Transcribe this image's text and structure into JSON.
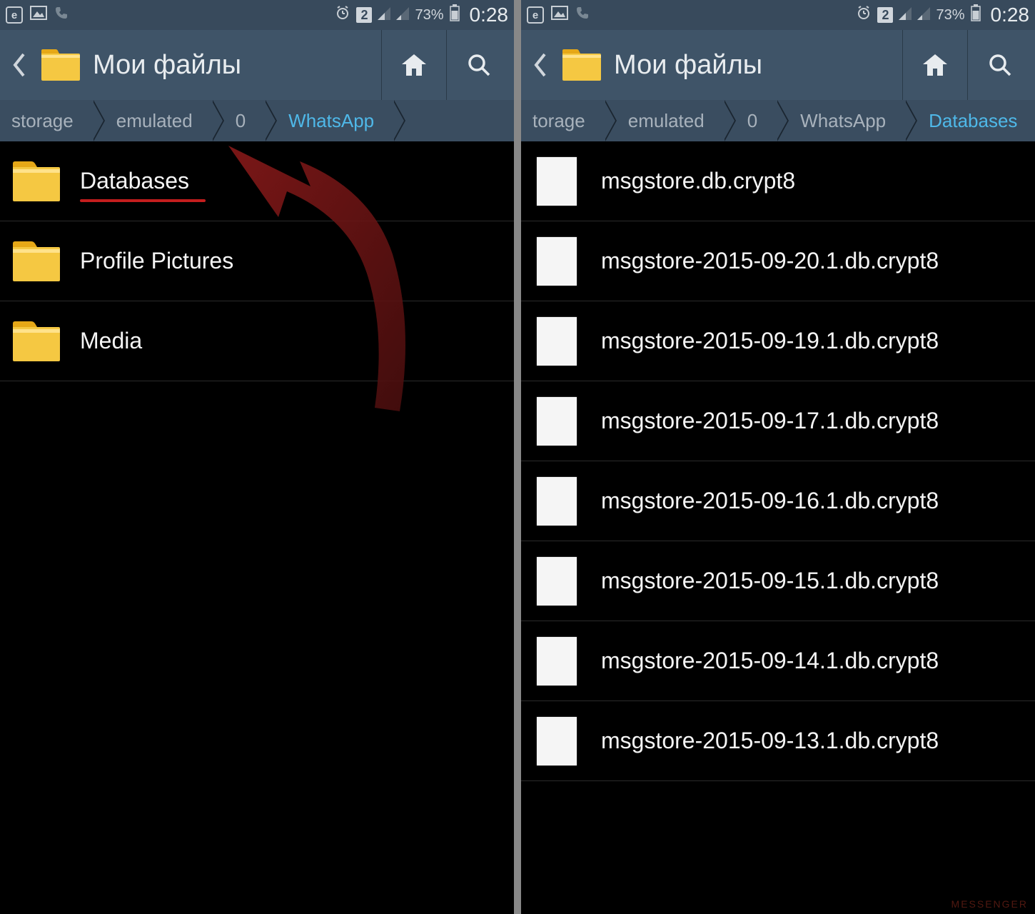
{
  "status": {
    "battery": "73%",
    "time": "0:28",
    "sim": "2"
  },
  "header": {
    "title": "Мои файлы"
  },
  "left": {
    "breadcrumb": [
      {
        "label": "storage",
        "active": false
      },
      {
        "label": "emulated",
        "active": false
      },
      {
        "label": "0",
        "active": false
      },
      {
        "label": "WhatsApp",
        "active": true
      }
    ],
    "items": [
      {
        "name": "Databases",
        "type": "folder",
        "highlighted": true
      },
      {
        "name": "Profile Pictures",
        "type": "folder",
        "highlighted": false
      },
      {
        "name": "Media",
        "type": "folder",
        "highlighted": false
      }
    ]
  },
  "right": {
    "breadcrumb": [
      {
        "label": "torage",
        "active": false
      },
      {
        "label": "emulated",
        "active": false
      },
      {
        "label": "0",
        "active": false
      },
      {
        "label": "WhatsApp",
        "active": false
      },
      {
        "label": "Databases",
        "active": true
      }
    ],
    "items": [
      {
        "name": "msgstore.db.crypt8",
        "type": "file"
      },
      {
        "name": "msgstore-2015-09-20.1.db.crypt8",
        "type": "file"
      },
      {
        "name": "msgstore-2015-09-19.1.db.crypt8",
        "type": "file"
      },
      {
        "name": "msgstore-2015-09-17.1.db.crypt8",
        "type": "file"
      },
      {
        "name": "msgstore-2015-09-16.1.db.crypt8",
        "type": "file"
      },
      {
        "name": "msgstore-2015-09-15.1.db.crypt8",
        "type": "file"
      },
      {
        "name": "msgstore-2015-09-14.1.db.crypt8",
        "type": "file"
      },
      {
        "name": "msgstore-2015-09-13.1.db.crypt8",
        "type": "file"
      }
    ]
  },
  "watermark": "MESSENGER"
}
